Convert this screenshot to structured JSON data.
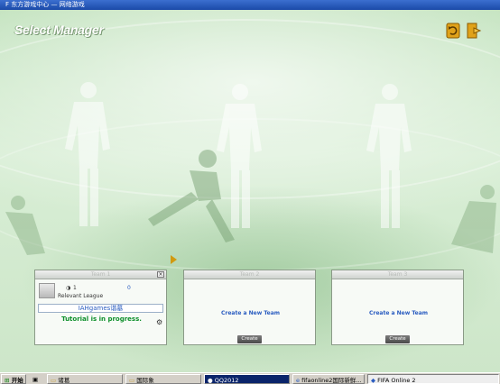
{
  "window": {
    "title": "F 东方游戏中心 — 网络游戏"
  },
  "header": {
    "title": "Select Manager"
  },
  "slots": [
    {
      "header": "Team 1",
      "stat_level": "1",
      "stat_value": "0",
      "league_label": "Relevant League",
      "team_name": "IAHgames谐墓",
      "status": "Tutorial is in progress."
    },
    {
      "header": "Team 2",
      "link": "Create a New Team",
      "button": "Create"
    },
    {
      "header": "Team 3",
      "link": "Create a New Team",
      "button": "Create"
    }
  ],
  "taskbar": {
    "start": "开始",
    "items": [
      "诸葛",
      "国际象",
      "QQ2012",
      "fifaonline2国际新鲜...",
      "FIFA Online 2"
    ]
  },
  "colors": {
    "accent": "#2a5cc0",
    "status": "#0d8f2a",
    "start_arrow": "#d19a10"
  },
  "icons": [
    "refresh-icon",
    "exit-icon",
    "close-icon",
    "gear-icon",
    "play-arrow-icon"
  ]
}
